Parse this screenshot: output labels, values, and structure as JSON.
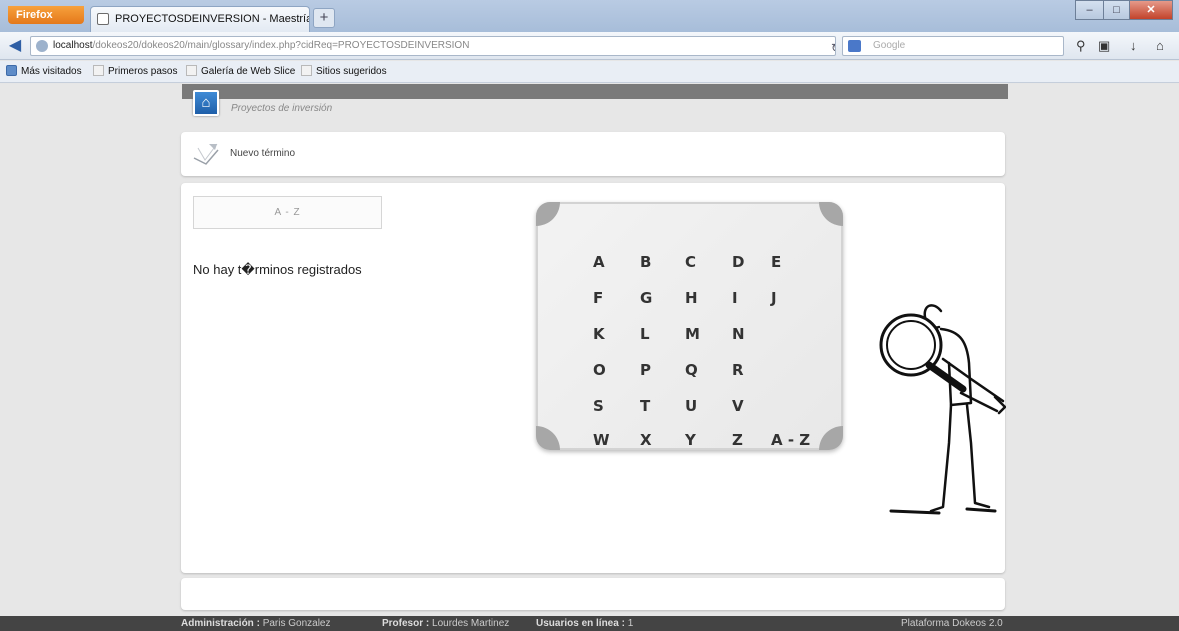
{
  "browser": {
    "app_button": "Firefox",
    "tab_title": "PROYECTOSDEINVERSION - Maestría en ...",
    "new_tab": "+",
    "url_host": "localhost",
    "url_path": "/dokeos20/dokeos20/main/glossary/index.php?cidReq=PROYECTOSDEINVERSION",
    "search_placeholder": "Google",
    "bookmarks": [
      "Más visitados",
      "Primeros pasos",
      "Galería de Web Slice",
      "Sitios sugeridos"
    ]
  },
  "page": {
    "breadcrumb": "Proyectos de inversión",
    "new_term_label": "Nuevo término",
    "az_tab_label": "A - Z",
    "empty_message": "No hay t�rminos registrados",
    "letters": [
      [
        "A",
        "B",
        "C",
        "D",
        "E"
      ],
      [
        "F",
        "G",
        "H",
        "I",
        "J"
      ],
      [
        "K",
        "L",
        "M",
        "N"
      ],
      [
        "O",
        "P",
        "Q",
        "R"
      ],
      [
        "S",
        "T",
        "U",
        "V"
      ],
      [
        "W",
        "X",
        "Y",
        "Z",
        "A - Z"
      ]
    ]
  },
  "footer": {
    "admin_label": "Administración :",
    "admin_name": "Paris Gonzalez",
    "teacher_label": "Profesor :",
    "teacher_name": "Lourdes Martinez",
    "users_label": "Usuarios en línea :",
    "users_count": "1",
    "platform": "Plataforma Dokeos 2.0"
  },
  "colors": {
    "accent_blue": "#2a6bb8",
    "header_strip": "#7a7a7a",
    "footer_bg": "#444444"
  }
}
